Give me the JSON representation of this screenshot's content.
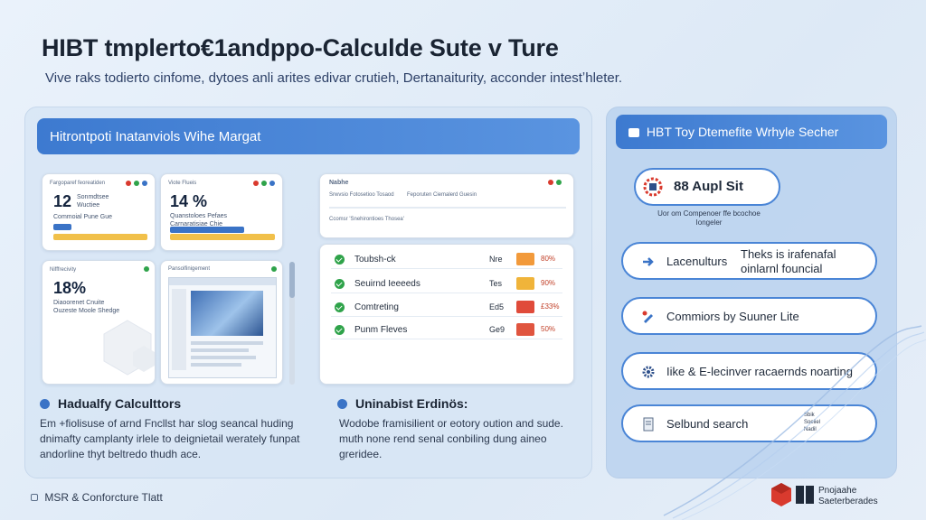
{
  "header": {
    "title": "HIBT tmplerto€1andppo-Calculde Sute v Ture",
    "subtitle": "Vive raks todierto cinfome, dytoes anli arites edivar crutieh, Dertanaiturity, acconder intestʼhleter."
  },
  "left_panel": {
    "header": "Hitrontpoti Inatanviols Wihe Margat",
    "card1": {
      "label": "Fargoparef feoreatiden",
      "value": "12",
      "sub1": "Sonmdtsee",
      "sub2": "Wuctiee",
      "sub3": "Commoial Pune Gue"
    },
    "card2": {
      "label": "Viote Flueis",
      "value": "14 %",
      "sub1": "Quanstoloes Pefaes",
      "sub2": "Carnaratisiae Chie"
    },
    "card3": {
      "label": "Nifffrecivity",
      "value": "18%",
      "sub1": "Diaoorenet Cnuite",
      "sub2": "Ouzeste Moole Shedge"
    },
    "card4": {
      "label": "Pansolfinigement"
    },
    "card5": {
      "label": "Nabhe",
      "line1": "Srwvsio Fotosetioo Tosaod",
      "line2": "Feporuten Ciemalerd Guesin",
      "line3": "Ccomsr 'Snehirontioes Thosea'"
    },
    "table_rows": [
      {
        "name": "Toubsh-ck",
        "col": "Nre",
        "pct": "80%",
        "chip_color": "#f29a3b"
      },
      {
        "name": "Seuirnd Ieeeeds",
        "col": "Tes",
        "pct": "90%",
        "chip_color": "#f0b43a"
      },
      {
        "name": "Comtreting",
        "col": "Ed5",
        "pct": "£33%",
        "chip_color": "#e04b3a"
      },
      {
        "name": "Punm Fleves",
        "col": "Ge9",
        "pct": "50%",
        "chip_color": "#e0553f"
      }
    ],
    "section1": {
      "title": "Hadualfy Calculttors",
      "body": "Em +fiolisuse of arnd Fncllst har slog seancal huding dnimafty camplanty irlele to deignietail werately funpat andorline thyt beltredo thudh ace."
    },
    "section2": {
      "title": "Uninabist Erdinös:",
      "body": "Wodobe framisilient or eotory oution and sude. muth none rend senal conbiling dung aineo greridee."
    }
  },
  "right_panel": {
    "header": "HBT Toy Dtemefite Wrhyle Secher",
    "badge": {
      "title": "88 Aupl Sit",
      "caption": "Uor om Compenoer ffe bcochoe Iongeler"
    },
    "items": [
      {
        "label": "Lacenulturs",
        "extra": "Theks is irafenafal oinlarnl founcial",
        "icon": "arrow-icon"
      },
      {
        "label": "Commiors by Suuner Lite",
        "icon": "pencil-icon"
      },
      {
        "label": "Iike & E-lecinver racaernds noarting",
        "icon": "gear-icon"
      },
      {
        "label": "Selbund search",
        "icon": "document-icon",
        "side": "Sbik Soeliel Nadil"
      }
    ]
  },
  "footer": {
    "text": "MSR & Conforcture Tlatt",
    "brand_line1": "Pnojaahe",
    "brand_line2": "Saeterberades"
  },
  "colors": {
    "accent": "#3d7ad0",
    "green": "#2fa34a",
    "red": "#d93a2e"
  }
}
